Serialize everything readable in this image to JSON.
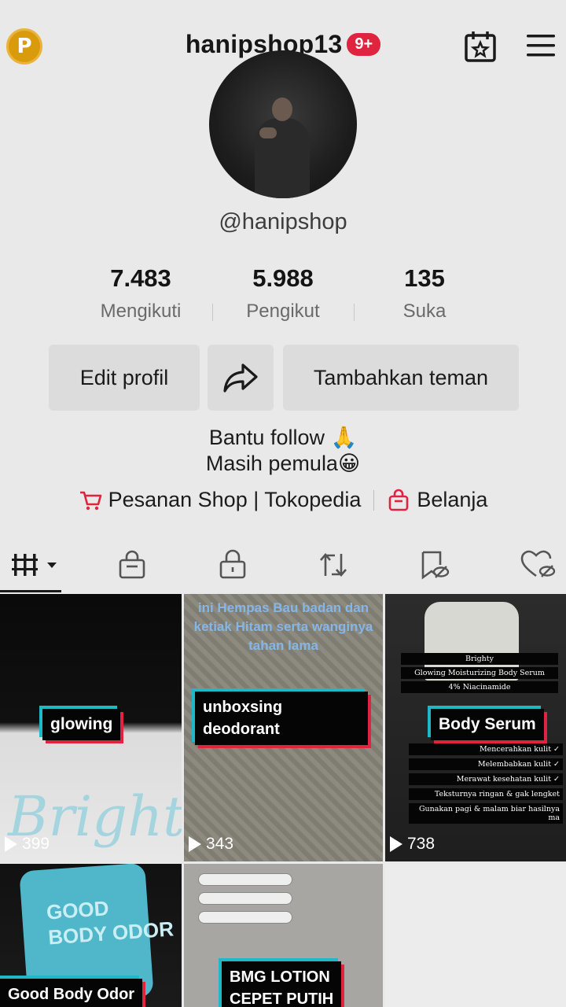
{
  "header": {
    "username": "hanipshop13",
    "notification_badge": "9+",
    "coin_letter": "P"
  },
  "profile": {
    "handle": "@hanipshop",
    "stats": [
      {
        "value": "7.483",
        "label": "Mengikuti"
      },
      {
        "value": "5.988",
        "label": "Pengikut"
      },
      {
        "value": "135",
        "label": "Suka"
      }
    ],
    "buttons": {
      "edit": "Edit profil",
      "add_friend": "Tambahkan teman"
    },
    "bio_line1": "Bantu follow 🙏",
    "bio_line2": "Masih pemula😀",
    "links": {
      "orders": "Pesanan Shop | Tokopedia",
      "shop": "Belanja"
    }
  },
  "tabs": [
    "videos-tab",
    "shop-tab",
    "private-tab",
    "repost-tab",
    "favorites-tab",
    "liked-tab"
  ],
  "colors": {
    "accent": "#e0243f",
    "teal": "#1fb8c9",
    "coin": "#d99a0c"
  },
  "videos": [
    {
      "caption": "glowing",
      "top_text": "",
      "views": "399"
    },
    {
      "caption_line1": "unboxsing",
      "caption_line2": "deodorant",
      "top_text": "ini Hempas Bau badan dan ketiak Hitam serta wanginya tahan lama",
      "views": "343"
    },
    {
      "caption": "Body Serum",
      "views": "738",
      "lines_top": [
        "Brighty",
        "Glowing Moisturizing Body Serum",
        "4% Niacinamide"
      ],
      "lines_bottom": [
        "Mencerahkan kulit ✓",
        "Melembabkan kulit ✓",
        "Merawat kesehatan kulit ✓",
        "Teksturnya ringan & gak lengket",
        "Gunakan pagi & malam biar hasilnya ma"
      ]
    },
    {
      "caption": "Good Body Odor",
      "tube_text_line1": "GOOD",
      "tube_text_line2": "BODY ODOR"
    },
    {
      "caption_line1": "BMG LOTION",
      "caption_line2": "CEPET PUTIH"
    }
  ]
}
